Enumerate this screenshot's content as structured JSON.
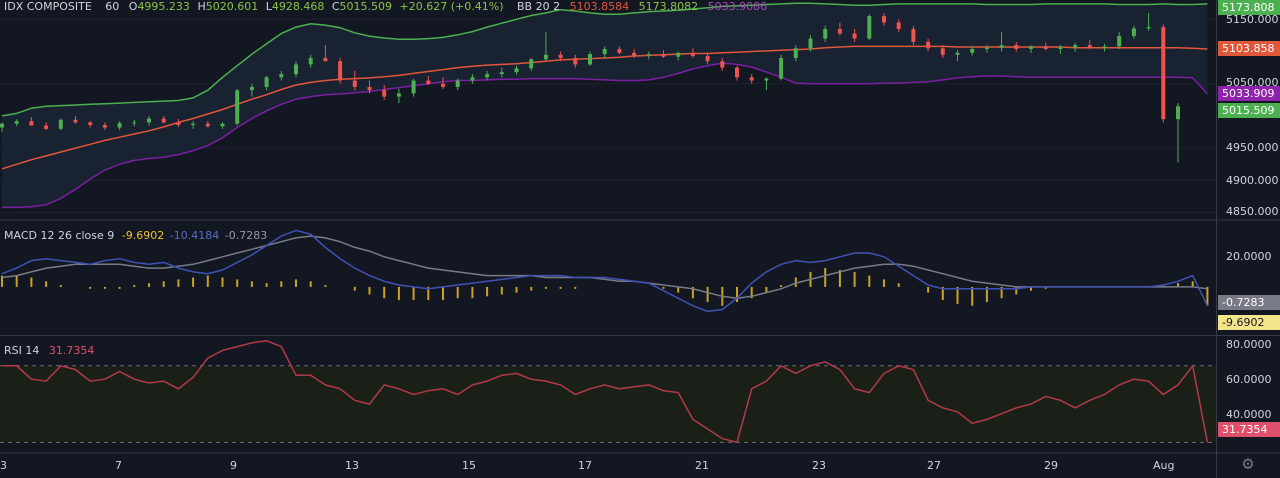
{
  "header": {
    "symbol": "IDX COMPOSITE",
    "interval": "60",
    "open_label": "O",
    "open": "4995.233",
    "high_label": "H",
    "high": "5020.601",
    "low_label": "L",
    "low": "4928.468",
    "close_label": "C",
    "close": "5015.509",
    "change": "+20.627 (+0.41%)",
    "bb_label": "BB 20 2",
    "bb_basis": "5103.8584",
    "bb_upper": "5173.8082",
    "bb_lower": "5033.9086"
  },
  "macd_header": {
    "label": "MACD 12 26 close 9",
    "hist": "-9.6902",
    "macd": "-10.4184",
    "signal": "-0.7283"
  },
  "rsi_header": {
    "label": "RSI 14",
    "value": "31.7354"
  },
  "price_axis": [
    "5150.000",
    "5050.000",
    "4950.000",
    "4900.000",
    "4850.000"
  ],
  "price_tags": {
    "upper": "5173.808",
    "basis": "5103.858",
    "lower": "5033.909",
    "last": "5015.509"
  },
  "macd_axis": [
    "20.0000"
  ],
  "macd_tags": {
    "signal": "-0.7283",
    "macd": "-9.6902"
  },
  "rsi_axis": [
    "80.0000",
    "60.0000",
    "40.0000"
  ],
  "rsi_tag": "31.7354",
  "time_axis": [
    "3",
    "7",
    "9",
    "13",
    "15",
    "17",
    "21",
    "23",
    "27",
    "29",
    "Aug"
  ],
  "colors": {
    "bg": "#131722",
    "up": "#26a69a",
    "up_bright": "#4caf50",
    "down": "#ef5350",
    "bb_upper": "#4caf50",
    "bb_basis": "#e0573a",
    "bb_lower": "#7b1fa2",
    "macd": "#3f51b5",
    "signal": "#787b86",
    "hist": "#c9a227",
    "rsi": "#b23a48",
    "up_text": "#8bc34a"
  },
  "chart_data": [
    {
      "type": "candlestick",
      "title": "IDX COMPOSITE",
      "interval": "60",
      "ylim": [
        4840,
        5180
      ],
      "x_ticks": [
        "3",
        "7",
        "9",
        "13",
        "15",
        "17",
        "21",
        "23",
        "27",
        "29",
        "Aug"
      ],
      "y_ticks": [
        5150,
        5050,
        4950,
        4900,
        4850
      ],
      "candles": [
        [
          4982,
          4990,
          4975,
          4988
        ],
        [
          4988,
          4995,
          4984,
          4992
        ],
        [
          4992,
          4998,
          4988,
          4985
        ],
        [
          4985,
          4990,
          4978,
          4980
        ],
        [
          4980,
          4996,
          4978,
          4994
        ],
        [
          4994,
          5000,
          4988,
          4990
        ],
        [
          4990,
          4992,
          4982,
          4986
        ],
        [
          4986,
          4990,
          4978,
          4982
        ],
        [
          4982,
          4992,
          4978,
          4989
        ],
        [
          4989,
          4994,
          4984,
          4990
        ],
        [
          4990,
          5000,
          4985,
          4996
        ],
        [
          4996,
          5000,
          4988,
          4990
        ],
        [
          4990,
          4995,
          4983,
          4986
        ],
        [
          4986,
          4992,
          4980,
          4988
        ],
        [
          4988,
          4992,
          4982,
          4984
        ],
        [
          4984,
          4990,
          4980,
          4988
        ],
        [
          4988,
          5042,
          4985,
          5040
        ],
        [
          5040,
          5050,
          5030,
          5045
        ],
        [
          5045,
          5062,
          5040,
          5060
        ],
        [
          5060,
          5070,
          5055,
          5065
        ],
        [
          5065,
          5085,
          5060,
          5080
        ],
        [
          5080,
          5095,
          5075,
          5090
        ],
        [
          5090,
          5110,
          5085,
          5085
        ],
        [
          5085,
          5090,
          5050,
          5055
        ],
        [
          5055,
          5070,
          5040,
          5045
        ],
        [
          5045,
          5055,
          5035,
          5040
        ],
        [
          5040,
          5048,
          5025,
          5030
        ],
        [
          5030,
          5042,
          5020,
          5035
        ],
        [
          5035,
          5058,
          5030,
          5055
        ],
        [
          5055,
          5062,
          5048,
          5050
        ],
        [
          5050,
          5060,
          5042,
          5045
        ],
        [
          5045,
          5058,
          5040,
          5055
        ],
        [
          5055,
          5065,
          5050,
          5060
        ],
        [
          5060,
          5070,
          5055,
          5065
        ],
        [
          5065,
          5075,
          5060,
          5068
        ],
        [
          5068,
          5078,
          5064,
          5074
        ],
        [
          5074,
          5090,
          5070,
          5088
        ],
        [
          5088,
          5130,
          5085,
          5095
        ],
        [
          5095,
          5100,
          5085,
          5090
        ],
        [
          5090,
          5095,
          5075,
          5080
        ],
        [
          5080,
          5100,
          5078,
          5096
        ],
        [
          5096,
          5108,
          5090,
          5104
        ],
        [
          5104,
          5108,
          5096,
          5098
        ],
        [
          5098,
          5104,
          5090,
          5094
        ],
        [
          5094,
          5100,
          5088,
          5096
        ],
        [
          5096,
          5102,
          5090,
          5092
        ],
        [
          5092,
          5100,
          5086,
          5098
        ],
        [
          5098,
          5105,
          5090,
          5093
        ],
        [
          5093,
          5098,
          5080,
          5085
        ],
        [
          5085,
          5090,
          5070,
          5075
        ],
        [
          5075,
          5078,
          5055,
          5060
        ],
        [
          5060,
          5065,
          5050,
          5055
        ],
        [
          5055,
          5060,
          5040,
          5058
        ],
        [
          5058,
          5095,
          5055,
          5090
        ],
        [
          5090,
          5110,
          5085,
          5105
        ],
        [
          5105,
          5125,
          5100,
          5120
        ],
        [
          5120,
          5140,
          5115,
          5135
        ],
        [
          5135,
          5145,
          5125,
          5128
        ],
        [
          5128,
          5135,
          5115,
          5120
        ],
        [
          5120,
          5158,
          5118,
          5155
        ],
        [
          5155,
          5160,
          5140,
          5145
        ],
        [
          5145,
          5150,
          5130,
          5135
        ],
        [
          5135,
          5140,
          5110,
          5115
        ],
        [
          5115,
          5120,
          5100,
          5105
        ],
        [
          5105,
          5110,
          5090,
          5095
        ],
        [
          5095,
          5102,
          5085,
          5098
        ],
        [
          5098,
          5108,
          5094,
          5104
        ],
        [
          5104,
          5110,
          5098,
          5106
        ],
        [
          5106,
          5130,
          5100,
          5110
        ],
        [
          5110,
          5115,
          5100,
          5104
        ],
        [
          5104,
          5110,
          5098,
          5108
        ],
        [
          5108,
          5114,
          5102,
          5104
        ],
        [
          5104,
          5110,
          5096,
          5106
        ],
        [
          5106,
          5114,
          5100,
          5110
        ],
        [
          5110,
          5118,
          5104,
          5106
        ],
        [
          5106,
          5112,
          5100,
          5108
        ],
        [
          5108,
          5130,
          5104,
          5124
        ],
        [
          5124,
          5140,
          5120,
          5136
        ],
        [
          5136,
          5160,
          5132,
          5138
        ],
        [
          5138,
          5142,
          4990,
          4995
        ],
        [
          4995,
          5020,
          4928,
          5015
        ]
      ]
    },
    {
      "type": "line",
      "title": "BB 20 2",
      "series": [
        {
          "name": "BB upper",
          "values": [
            5000,
            5004,
            5012,
            5015,
            5016,
            5017,
            5018,
            5019,
            5020,
            5021,
            5022,
            5023,
            5024,
            5028,
            5040,
            5060,
            5078,
            5096,
            5112,
            5128,
            5138,
            5143,
            5141,
            5137,
            5129,
            5124,
            5121,
            5119,
            5119,
            5120,
            5122,
            5126,
            5131,
            5138,
            5144,
            5150,
            5156,
            5160,
            5165,
            5163,
            5160,
            5158,
            5158,
            5160,
            5162,
            5163,
            5164,
            5166,
            5168,
            5170,
            5171,
            5172,
            5173,
            5174,
            5175,
            5175,
            5174,
            5173,
            5172,
            5172,
            5173,
            5174,
            5174,
            5174,
            5174,
            5174,
            5174,
            5173,
            5173,
            5173,
            5173,
            5174,
            5174,
            5174,
            5174,
            5174,
            5173,
            5173,
            5173,
            5174,
            5173,
            5173,
            5174
          ]
        },
        {
          "name": "BB basis",
          "values": [
            4918,
            4925,
            4932,
            4938,
            4944,
            4950,
            4956,
            4962,
            4967,
            4972,
            4977,
            4983,
            4990,
            4996,
            5003,
            5010,
            5018,
            5026,
            5033,
            5041,
            5048,
            5052,
            5055,
            5057,
            5058,
            5059,
            5061,
            5063,
            5066,
            5069,
            5072,
            5075,
            5077,
            5079,
            5080,
            5081,
            5083,
            5085,
            5087,
            5088,
            5089,
            5090,
            5091,
            5093,
            5094,
            5095,
            5096,
            5097,
            5097,
            5098,
            5099,
            5100,
            5101,
            5102,
            5103,
            5104,
            5106,
            5107,
            5108,
            5108,
            5108,
            5108,
            5108,
            5108,
            5108,
            5107,
            5107,
            5107,
            5107,
            5107,
            5107,
            5107,
            5107,
            5106,
            5106,
            5106,
            5106,
            5106,
            5106,
            5106,
            5106,
            5105,
            5104
          ]
        },
        {
          "name": "BB lower",
          "values": [
            4858,
            4858,
            4859,
            4862,
            4872,
            4886,
            4902,
            4916,
            4925,
            4931,
            4934,
            4936,
            4940,
            4946,
            4954,
            4966,
            4982,
            4996,
            5008,
            5018,
            5026,
            5030,
            5033,
            5034,
            5036,
            5038,
            5041,
            5044,
            5047,
            5050,
            5053,
            5055,
            5055,
            5056,
            5057,
            5057,
            5058,
            5058,
            5058,
            5058,
            5057,
            5056,
            5055,
            5055,
            5056,
            5060,
            5066,
            5073,
            5078,
            5082,
            5080,
            5076,
            5068,
            5060,
            5051,
            5050,
            5050,
            5050,
            5050,
            5050,
            5051,
            5051,
            5052,
            5053,
            5056,
            5059,
            5061,
            5062,
            5062,
            5061,
            5060,
            5060,
            5060,
            5060,
            5060,
            5060,
            5060,
            5060,
            5060,
            5060,
            5060,
            5059,
            5034
          ]
        }
      ]
    },
    {
      "type": "line",
      "title": "MACD 12 26 close 9",
      "ylim": [
        -25,
        35
      ],
      "series": [
        {
          "name": "MACD",
          "values": [
            7,
            10,
            14,
            15,
            14,
            13,
            12,
            14,
            15,
            13,
            12,
            13,
            10,
            8,
            7,
            9,
            13,
            17,
            22,
            27,
            30,
            28,
            21,
            15,
            10,
            6,
            3,
            1,
            0,
            -1,
            0,
            1,
            2,
            3,
            4,
            5,
            6,
            6,
            6,
            5,
            5,
            5,
            4,
            3,
            2,
            -2,
            -6,
            -10,
            -13,
            -12,
            -6,
            2,
            8,
            12,
            14,
            13,
            14,
            16,
            18,
            18,
            16,
            11,
            6,
            1,
            -1,
            -1,
            -1,
            -1,
            -1,
            -1,
            0,
            0,
            0,
            0,
            0,
            0,
            0,
            0,
            0,
            1,
            3,
            6,
            -10
          ]
        },
        {
          "name": "Signal",
          "values": [
            5,
            6,
            8,
            10,
            11,
            12,
            12,
            12,
            12,
            11,
            10,
            10,
            11,
            12,
            14,
            16,
            18,
            20,
            22,
            24,
            26,
            27,
            26,
            24,
            21,
            19,
            16,
            14,
            12,
            10,
            9,
            8,
            7,
            6,
            6,
            6,
            6,
            5,
            5,
            5,
            5,
            4,
            3,
            3,
            2,
            1,
            0,
            -1,
            -3,
            -5,
            -6,
            -5,
            -3,
            -1,
            2,
            4,
            6,
            8,
            10,
            11,
            12,
            12,
            11,
            9,
            7,
            5,
            3,
            2,
            1,
            0,
            0,
            0,
            0,
            0,
            0,
            0,
            0,
            0,
            0,
            0,
            0,
            0,
            -1
          ]
        }
      ],
      "histogram": [
        6,
        6,
        5,
        3,
        1,
        0,
        -1,
        -1,
        -1,
        1,
        2,
        3,
        4,
        5,
        6,
        5,
        4,
        3,
        2,
        3,
        4,
        3,
        1,
        0,
        -2,
        -4,
        -6,
        -7,
        -7,
        -7,
        -7,
        -6,
        -6,
        -5,
        -4,
        -3,
        -2,
        -1,
        -1,
        -1,
        0,
        0,
        0,
        0,
        0,
        -1,
        -3,
        -6,
        -8,
        -10,
        -8,
        -6,
        -3,
        1,
        5,
        8,
        10,
        9,
        8,
        6,
        4,
        2,
        0,
        -3,
        -7,
        -9,
        -10,
        -8,
        -6,
        -4,
        -2,
        -1,
        0,
        0,
        0,
        0,
        0,
        0,
        0,
        1,
        2,
        3,
        -10
      ]
    },
    {
      "type": "line",
      "title": "RSI 14",
      "ylim": [
        25,
        85
      ],
      "y_ticks": [
        80,
        60,
        40
      ],
      "bands": [
        70,
        30
      ],
      "series": [
        {
          "name": "RSI",
          "values": [
            70,
            70,
            63,
            62,
            70,
            68,
            62,
            63,
            67,
            63,
            61,
            62,
            58,
            64,
            74,
            78,
            80,
            82,
            83,
            80,
            65,
            65,
            60,
            58,
            52,
            50,
            60,
            58,
            55,
            57,
            58,
            55,
            60,
            62,
            65,
            66,
            63,
            62,
            60,
            55,
            58,
            60,
            58,
            59,
            60,
            57,
            56,
            42,
            37,
            32,
            30,
            58,
            62,
            70,
            66,
            70,
            72,
            68,
            58,
            56,
            66,
            70,
            68,
            52,
            48,
            46,
            40,
            42,
            45,
            48,
            50,
            54,
            52,
            48,
            52,
            55,
            60,
            63,
            62,
            55,
            60,
            70,
            30
          ]
        }
      ]
    }
  ]
}
